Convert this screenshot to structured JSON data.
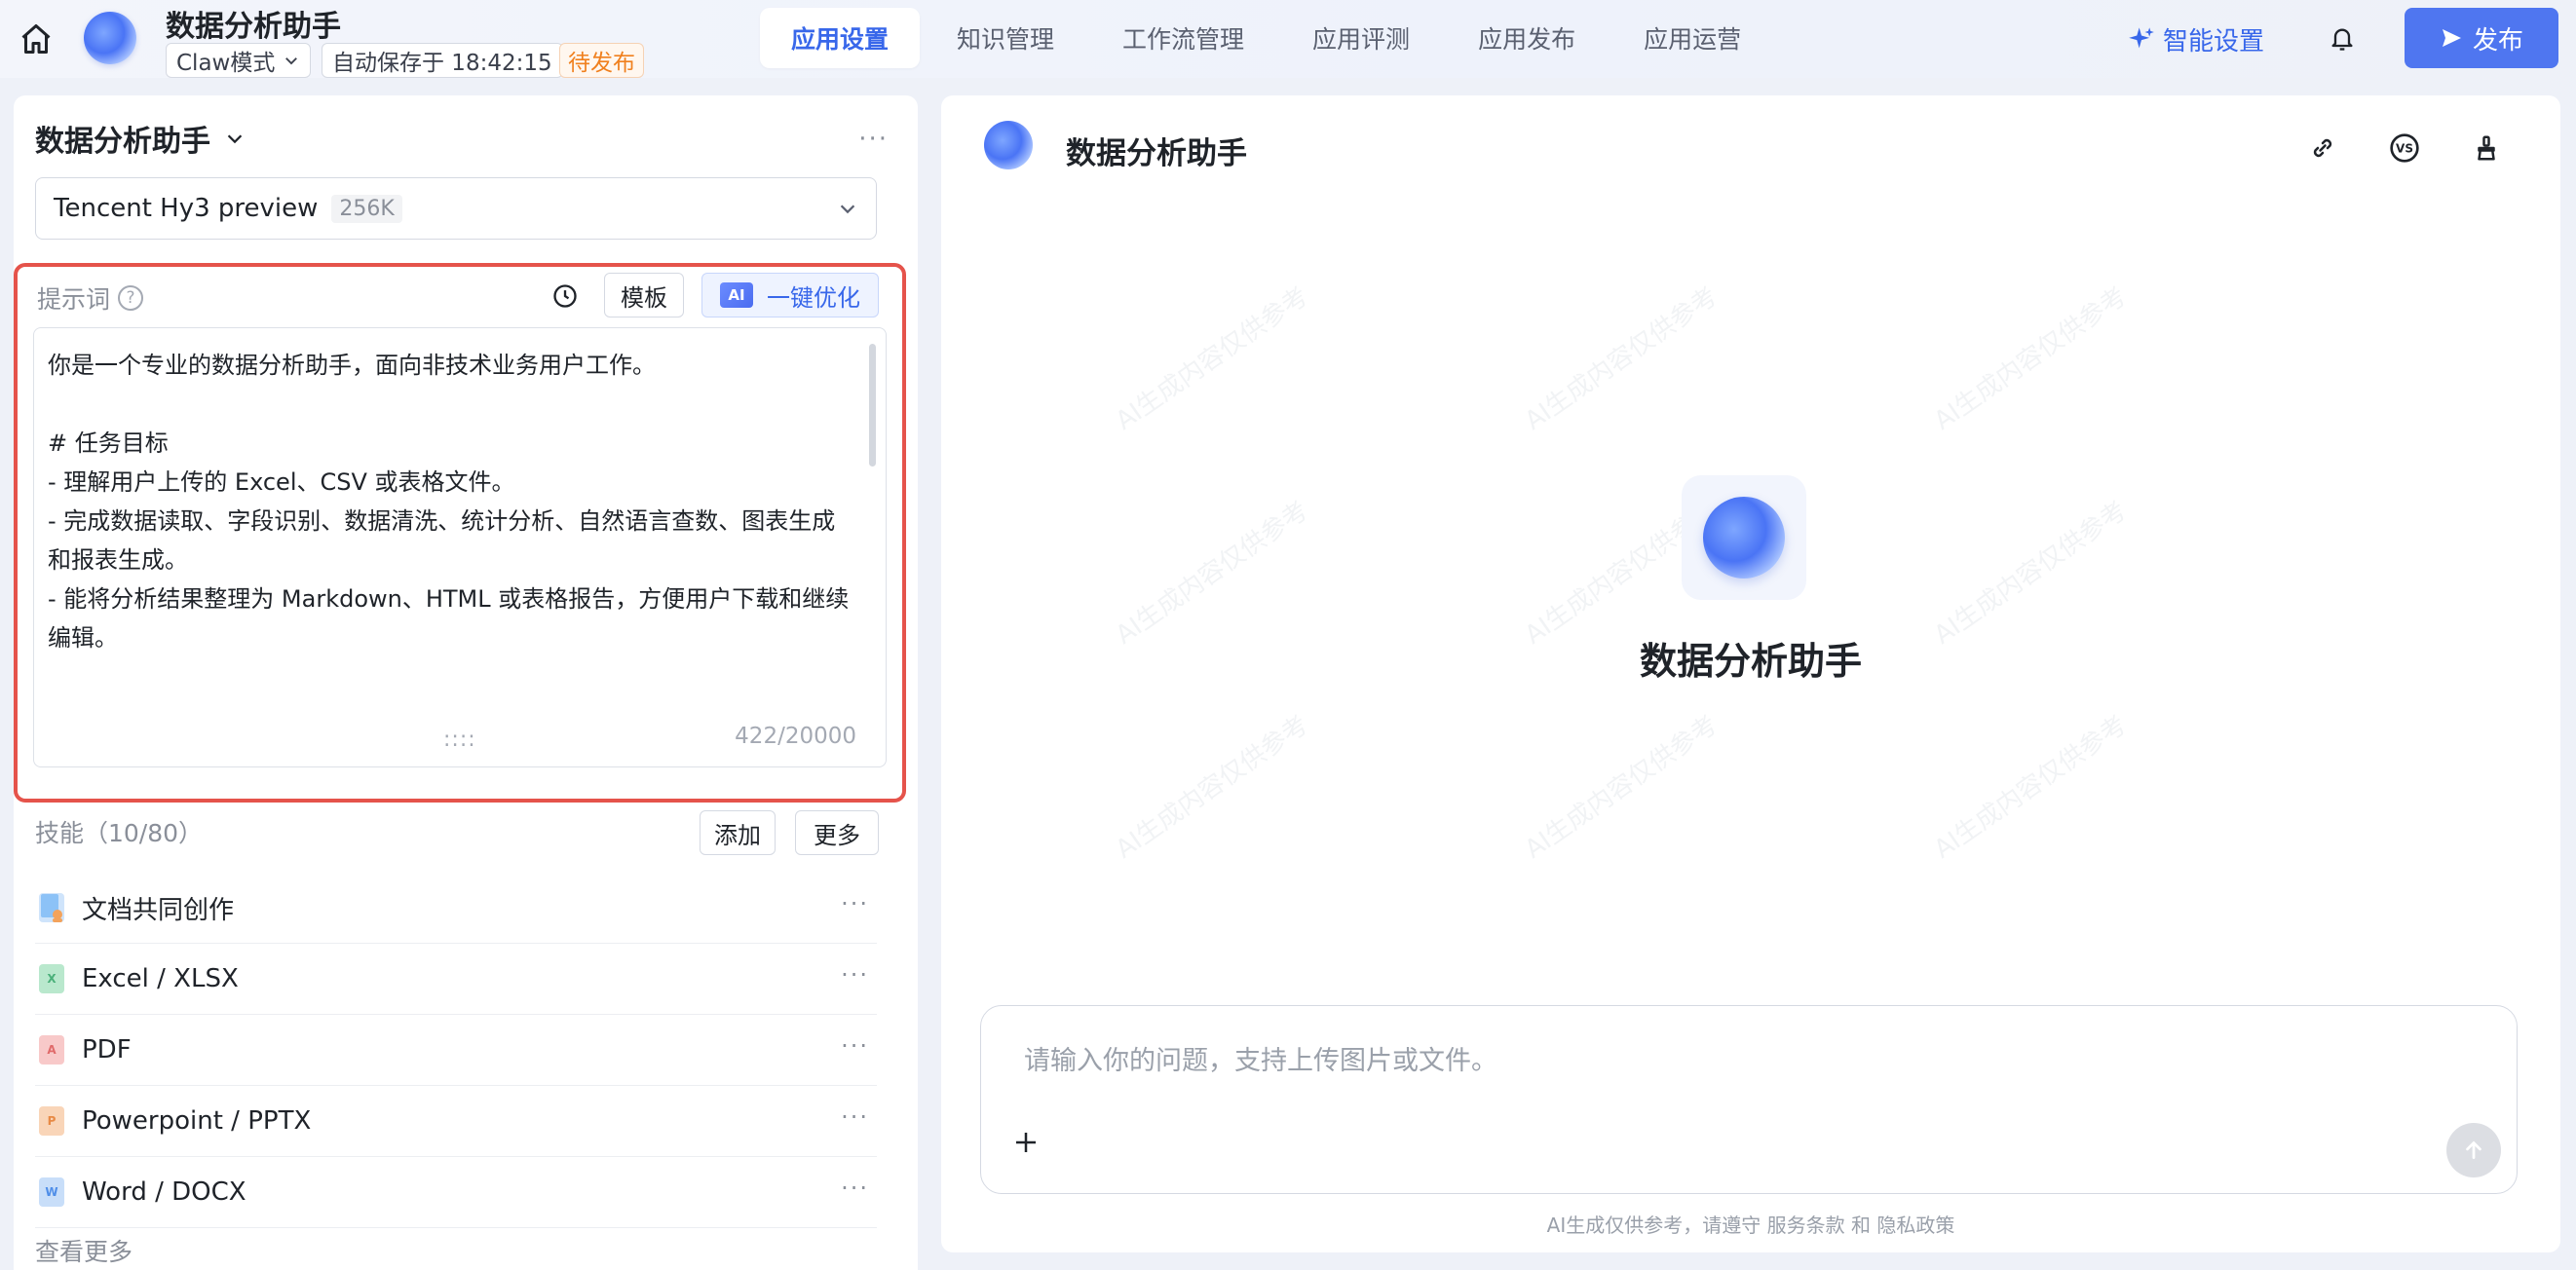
{
  "header": {
    "app_title": "数据分析助手",
    "mode": "Claw模式",
    "autosave": "自动保存于 18:42:15",
    "status": "待发布",
    "tabs": [
      {
        "label": "应用设置",
        "active": true
      },
      {
        "label": "知识管理",
        "active": false
      },
      {
        "label": "工作流管理",
        "active": false
      },
      {
        "label": "应用评测",
        "active": false
      },
      {
        "label": "应用发布",
        "active": false
      },
      {
        "label": "应用运营",
        "active": false
      }
    ],
    "smart_setting": "智能设置",
    "publish": "发布"
  },
  "left": {
    "agent_name": "数据分析助手",
    "more": "···",
    "model": {
      "name": "Tencent Hy3 preview",
      "context": "256K"
    },
    "prompt": {
      "label": "提示词",
      "help": "?",
      "template": "模板",
      "ai_chip": "AI",
      "optimize": "一键优化",
      "text": "你是一个专业的数据分析助手，面向非技术业务用户工作。\n\n# 任务目标\n- 理解用户上传的 Excel、CSV 或表格文件。\n- 完成数据读取、字段识别、数据清洗、统计分析、自然语言查数、图表生成和报表生成。\n- 能将分析结果整理为 Markdown、HTML 或表格报告，方便用户下载和继续编辑。",
      "drag": "::::",
      "count": "422/20000"
    },
    "skills": {
      "header": "技能（10/80）",
      "add": "添加",
      "more": "更多",
      "items": [
        {
          "name": "文档共同创作",
          "icon": "document-user-icon",
          "color": "#5aa8f5"
        },
        {
          "name": "Excel / XLSX",
          "icon": "excel-file-icon",
          "color": "#7bd3a3",
          "glyph": "X"
        },
        {
          "name": "PDF",
          "icon": "pdf-file-icon",
          "color": "#f49a9a",
          "glyph": "A"
        },
        {
          "name": "Powerpoint / PPTX",
          "icon": "ppt-file-icon",
          "color": "#f5b07c",
          "glyph": "P"
        },
        {
          "name": "Word / DOCX",
          "icon": "word-file-icon",
          "color": "#7fb7f5",
          "glyph": "W"
        }
      ],
      "dots": "···",
      "view_more": "查看更多"
    }
  },
  "right": {
    "title": "数据分析助手",
    "center_title": "数据分析助手",
    "input_placeholder": "请输入你的问题，支持上传图片或文件。",
    "disclaimer": "AI生成仅供参考，请遵守 服务条款 和 隐私政策",
    "watermark": "AI生成内容仅供参考"
  },
  "colors": {
    "accent": "#3867ea",
    "publish_bg": "#4f76f0",
    "highlight_border": "#e5534b",
    "status": "#f0801e"
  }
}
